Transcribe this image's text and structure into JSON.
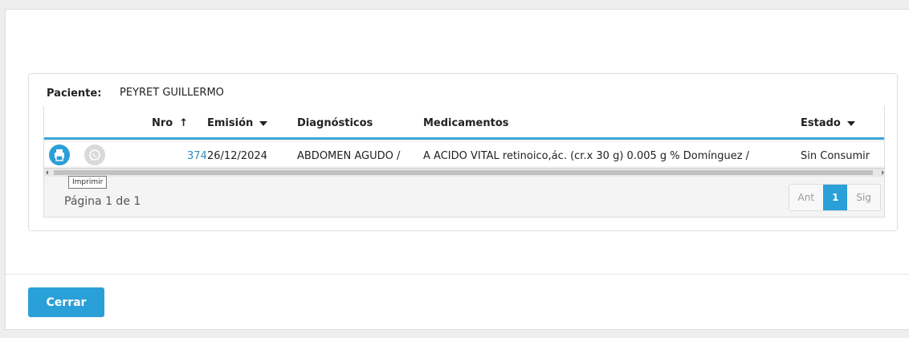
{
  "patient": {
    "label": "Paciente:",
    "name": "PEYRET GUILLERMO"
  },
  "table": {
    "columns": [
      {
        "key": "nro",
        "label": "Nro",
        "sort": "asc"
      },
      {
        "key": "emision",
        "label": "Emisión",
        "sort": "menu"
      },
      {
        "key": "diagnosticos",
        "label": "Diagnósticos"
      },
      {
        "key": "medicamentos",
        "label": "Medicamentos"
      },
      {
        "key": "estado",
        "label": "Estado",
        "sort": "menu"
      }
    ],
    "rows": [
      {
        "nro": "374",
        "emision": "26/12/2024",
        "diagnosticos": "ABDOMEN AGUDO /",
        "medicamentos": "A ACIDO VITAL retinoico,ác. (cr.x 30 g) 0.005 g % Domínguez /",
        "estado": "Sin Consumir"
      }
    ],
    "row_actions": {
      "print_icon": "printer-icon",
      "whatsapp_icon": "whatsapp-icon",
      "tooltip": "Imprimir"
    }
  },
  "pagination": {
    "summary": "Página 1 de 1",
    "prev": "Ant",
    "current": "1",
    "next": "Sig"
  },
  "footer": {
    "close_label": "Cerrar"
  },
  "colors": {
    "accent": "#2aa0d8",
    "link": "#2a8fc1"
  }
}
